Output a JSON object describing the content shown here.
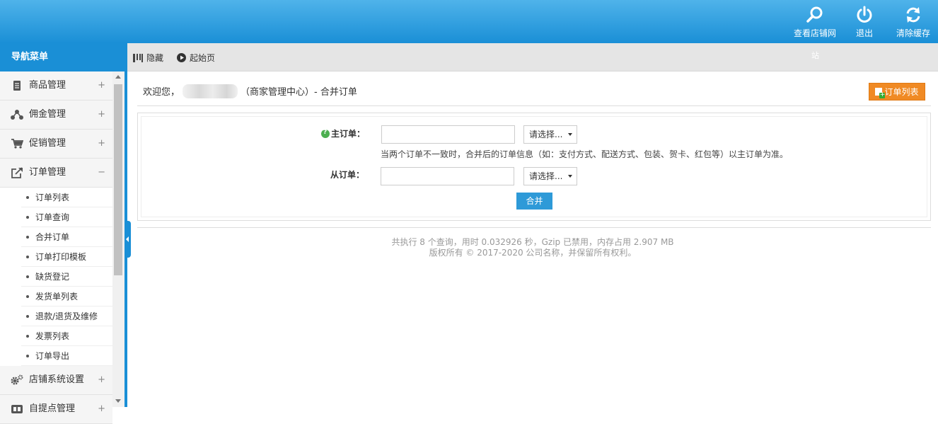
{
  "header": {
    "actions": [
      {
        "label": "查看店铺网",
        "icon": "search-icon"
      },
      {
        "label": "退出",
        "icon": "power-icon"
      },
      {
        "label": "清除缓存",
        "icon": "refresh-icon"
      }
    ]
  },
  "sidebar": {
    "title": "导航菜单",
    "groups": [
      {
        "label": "商品管理",
        "icon": "goods-icon",
        "toggle": "+"
      },
      {
        "label": "佣金管理",
        "icon": "share-icon",
        "toggle": "+"
      },
      {
        "label": "促销管理",
        "icon": "cart-icon",
        "toggle": "+"
      },
      {
        "label": "订单管理",
        "icon": "export-icon",
        "toggle": "−"
      },
      {
        "label": "店铺系统设置",
        "icon": "gears-icon",
        "toggle": "+"
      },
      {
        "label": "自提点管理",
        "icon": "pickup-icon",
        "toggle": "+"
      }
    ],
    "order_sub_items": [
      "订单列表",
      "订单查询",
      "合并订单",
      "订单打印模板",
      "缺货登记",
      "发货单列表",
      "退款/退货及维修",
      "发票列表",
      "订单导出"
    ]
  },
  "toolbar": {
    "hide_label": "隐藏",
    "home_label": "起始页",
    "stray_char": "站"
  },
  "content": {
    "welcome_prefix": "欢迎您，",
    "welcome_suffix": "（商家管理中心）- 合并订单",
    "order_list_button": "订单列表",
    "form": {
      "main_order_label": "主订单：",
      "sub_order_label": "从订单：",
      "main_order_value": "",
      "sub_order_value": "",
      "select_placeholder": "请选择...",
      "hint": "当两个订单不一致时，合并后的订单信息（如：支付方式、配送方式、包装、贺卡、红包等）以主订单为准。",
      "merge_button": "合并"
    },
    "footer": {
      "line1": "共执行 8 个查询，用时 0.032926 秒，Gzip 已禁用，内存占用 2.907 MB",
      "line2": "版权所有 © 2017-2020 公司名称，并保留所有权利。"
    }
  },
  "colors": {
    "header_blue": "#1a8fd6",
    "order_btn_orange": "#f08a24",
    "merge_btn_blue": "#2e9ad8"
  }
}
